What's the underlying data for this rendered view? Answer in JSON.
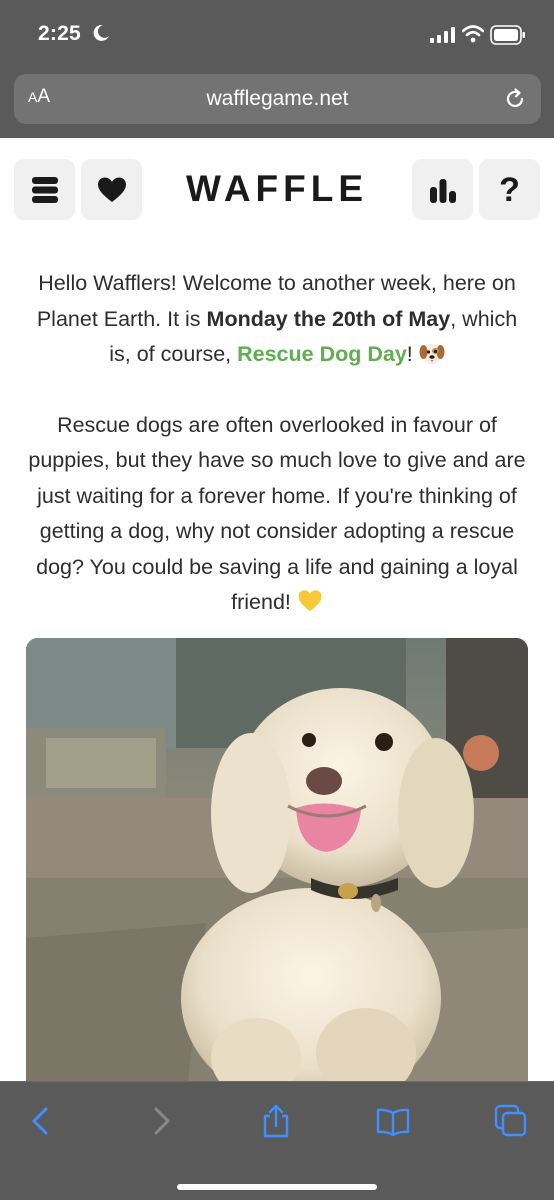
{
  "status_bar": {
    "time": "2:25",
    "moon_icon": "moon-icon",
    "signal_icon": "cellular-signal-icon",
    "wifi_icon": "wifi-icon",
    "battery_icon": "battery-icon"
  },
  "browser": {
    "text_size_label_small": "A",
    "text_size_label_large": "A",
    "url": "wafflegame.net",
    "reload_icon": "reload-icon"
  },
  "header": {
    "logo": "WAFFLE",
    "menu_icon": "menu-icon",
    "heart_icon": "heart-icon",
    "stats_icon": "bar-chart-icon",
    "help_label": "?"
  },
  "message": {
    "p1_a": "Hello Wafflers! Welcome to another week, here on Planet Earth. It is ",
    "p1_bold": "Monday the 20th of May",
    "p1_b": ", which is, of course, ",
    "p1_green": "Rescue Dog Day",
    "p1_c": "! ",
    "p2": "Rescue dogs are often overlooked in favour of puppies, but they have so much love to give and are just waiting for a forever home. If you're thinking of getting a dog, why not consider adopting a rescue dog? You could be saving a life and gaining a loyal friend! ",
    "dog_emoji_icon": "dog-face-icon",
    "heart_emoji_icon": "yellow-heart-icon",
    "accent_color": "#5fae4f"
  },
  "photo": {
    "subject": "fluffy-white-dog-photo"
  },
  "toolbar": {
    "back_icon": "back-chevron-icon",
    "forward_icon": "forward-chevron-icon",
    "share_icon": "share-icon",
    "bookmarks_icon": "bookmarks-icon",
    "tabs_icon": "tabs-icon",
    "active_color": "#3f8fff",
    "disabled_color": "#8a8a8a"
  }
}
